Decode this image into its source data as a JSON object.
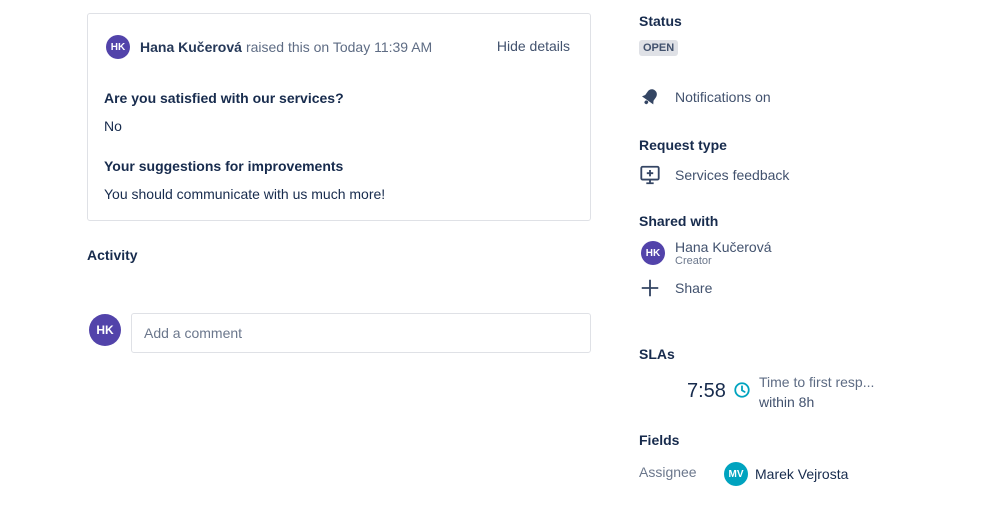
{
  "request": {
    "raiser_initials": "HK",
    "raiser_name": "Hana Kučerová",
    "raised_text": "raised this on Today 11:39 AM",
    "hide_details_label": "Hide details",
    "questions": [
      {
        "question": "Are you satisfied with our services?",
        "answer": "No"
      },
      {
        "question": "Your suggestions for improvements",
        "answer": "You should communicate with us much more!"
      }
    ]
  },
  "activity": {
    "title": "Activity",
    "user_initials": "HK",
    "comment_placeholder": "Add a comment"
  },
  "sidebar": {
    "status_label": "Status",
    "status_value": "OPEN",
    "notifications_label": "Notifications on",
    "request_type_label": "Request type",
    "request_type_value": "Services feedback",
    "shared_with_label": "Shared with",
    "shared_person_initials": "HK",
    "shared_person_name": "Hana Kučerová",
    "shared_person_role": "Creator",
    "share_label": "Share",
    "slas_label": "SLAs",
    "sla_time": "7:58",
    "sla_goal": "Time to first resp...",
    "sla_within": "within 8h",
    "fields_label": "Fields",
    "assignee_label": "Assignee",
    "assignee_initials": "MV",
    "assignee_name": "Marek Vejrosta"
  },
  "colors": {
    "avatar_purple": "#5243aa",
    "avatar_teal": "#00a3bf",
    "sla_clock": "#00a3bf",
    "lozenge_bg": "#dfe1e6"
  },
  "icons": [
    "bell-icon",
    "desktop-add-icon",
    "plus-icon",
    "clock-icon"
  ]
}
